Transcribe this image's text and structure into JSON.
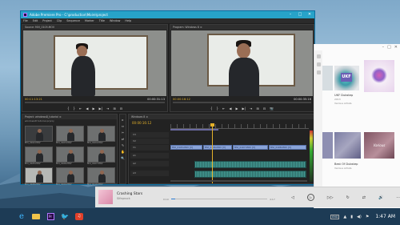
{
  "premiere": {
    "title": "Adobe Premiere Pro - C:\\production\\Moire\\project",
    "window_controls": {
      "minimize": "–",
      "maximize": "□",
      "close": "✕"
    },
    "menu": [
      "File",
      "Edit",
      "Project",
      "Clip",
      "Sequence",
      "Marker",
      "Title",
      "Window",
      "Help"
    ],
    "source_monitor": {
      "tab": "Source: MVI_0105.MOV",
      "timecode_left": "00:11:13:21",
      "timecode_right": "00:00:31:13"
    },
    "program_monitor": {
      "tab": "Program: Windows 8 ≡",
      "timecode_left": "00:00:16:12",
      "timecode_right": "00:00:35:16"
    },
    "transport": [
      "{",
      "}",
      "⇤",
      "◀",
      "▶",
      "▶|",
      "⇥",
      "⊞",
      "⊟",
      "📷"
    ],
    "project_panel": {
      "tab": "Project: windows8_tutorial ≡",
      "path": "windows8 tutorial.prproj",
      "items": [
        {
          "label": "MVI_0102.MOV",
          "tone": "dark"
        },
        {
          "label": "MVI_0103.MOV",
          "tone": "mid"
        },
        {
          "label": "MVI_0104.MOV",
          "tone": "mid"
        },
        {
          "label": "MVI_0105.MOV",
          "tone": "mid"
        },
        {
          "label": "MVI_0106.MOV",
          "tone": "mid"
        },
        {
          "label": "MVI_0107.MOV",
          "tone": "mid"
        },
        {
          "label": "MVI_0108.MOV",
          "tone": "light"
        },
        {
          "label": "MVI_0109.MOV",
          "tone": "mid"
        },
        {
          "label": "MVI_0110.MOV",
          "tone": "mid"
        }
      ]
    },
    "tools": [
      "▸",
      "⇔",
      "✂",
      "⇄",
      "✎",
      "✋",
      "🔍"
    ],
    "timeline": {
      "tab": "Windows 8 ≡",
      "timecode": "00:00:16:12",
      "tracks": [
        {
          "name": "V3",
          "clips": []
        },
        {
          "name": "V2",
          "clips": []
        },
        {
          "name": "V1",
          "clips": [
            "MVI_0105.MOV [V]",
            "MVI_0106.MOV [V]",
            "MVI_0107.MOV [V]",
            "MVI_0108.MOV [V]"
          ]
        },
        {
          "name": "A1",
          "clips": []
        },
        {
          "name": "A2",
          "clips": []
        },
        {
          "name": "A3",
          "clips": []
        }
      ]
    }
  },
  "music": {
    "window_controls": {
      "minimize": "–",
      "maximize": "□",
      "close": "✕"
    },
    "albums": [
      {
        "title": "UKF Dubstep",
        "subtitle": "2013",
        "artist": "Various Artists",
        "logo": "UKF"
      },
      {
        "title": "Best Of Dubstep",
        "subtitle": "",
        "artist": "Various Artists"
      },
      {
        "title": "Best Of Dubstep",
        "subtitle": "",
        "artist": "Various Artists"
      }
    ],
    "selected_album_title": "Best Of Dubstep",
    "pink_album_text": "Various",
    "now_playing": {
      "title": "Crashing Stars",
      "artist": "Sifeprock",
      "elapsed": "0:10",
      "total": "4:17",
      "progress": 0.04,
      "controls": [
        "◁",
        "▷",
        "▷▷",
        "↻",
        "⇄",
        "🔊",
        "⋯"
      ]
    }
  },
  "taskbar": {
    "pinned": [
      "start",
      "internet-explorer",
      "file-explorer",
      "premiere-pro",
      "twitter",
      "headphones"
    ],
    "tray": {
      "keyboard": "ENG",
      "up_arrow": "▲",
      "clock": "1:47 AM"
    }
  }
}
